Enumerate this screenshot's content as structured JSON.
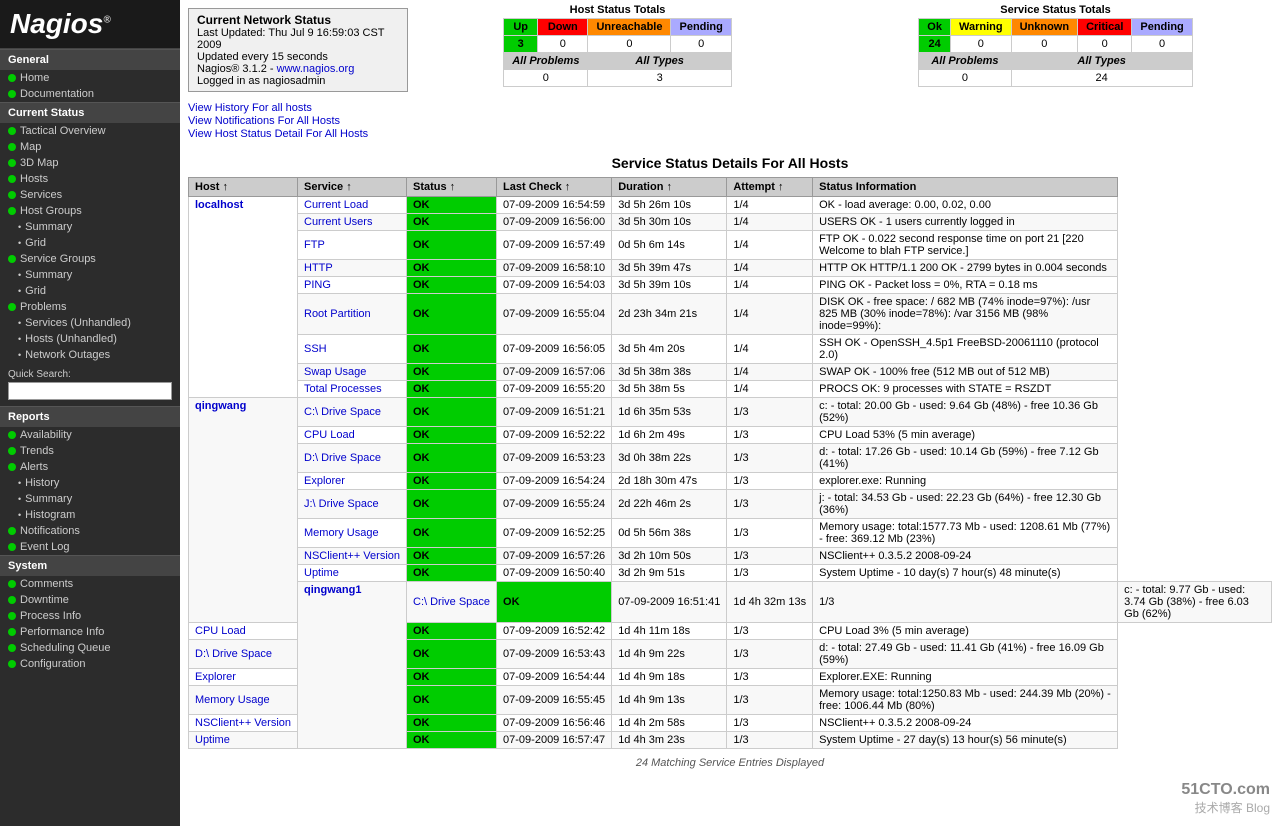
{
  "sidebar": {
    "logo": "Nagios",
    "logo_sup": "®",
    "sections": [
      {
        "label": "General",
        "items": [
          {
            "id": "home",
            "label": "Home",
            "dot": "green",
            "indent": 0
          },
          {
            "id": "documentation",
            "label": "Documentation",
            "dot": "green",
            "indent": 0
          }
        ]
      },
      {
        "label": "Current Status",
        "items": [
          {
            "id": "tactical-overview",
            "label": "Tactical Overview",
            "dot": "green",
            "indent": 0
          },
          {
            "id": "map",
            "label": "Map",
            "dot": "green",
            "indent": 0
          },
          {
            "id": "3d-map",
            "label": "3D Map",
            "dot": "green",
            "indent": 0
          },
          {
            "id": "hosts",
            "label": "Hosts",
            "dot": "green",
            "indent": 0
          },
          {
            "id": "services",
            "label": "Services",
            "dot": "green",
            "indent": 0
          },
          {
            "id": "host-groups",
            "label": "Host Groups",
            "dot": "green",
            "indent": 0
          },
          {
            "id": "hg-summary",
            "label": "Summary",
            "bullet": true,
            "indent": 1
          },
          {
            "id": "hg-grid",
            "label": "Grid",
            "bullet": true,
            "indent": 1
          },
          {
            "id": "service-groups",
            "label": "Service Groups",
            "dot": "green",
            "indent": 0
          },
          {
            "id": "sg-summary",
            "label": "Summary",
            "bullet": true,
            "indent": 1
          },
          {
            "id": "sg-grid",
            "label": "Grid",
            "bullet": true,
            "indent": 1
          },
          {
            "id": "problems",
            "label": "Problems",
            "dot": "green",
            "indent": 0
          },
          {
            "id": "prob-services",
            "label": "Services (Unhandled)",
            "bullet": true,
            "indent": 1
          },
          {
            "id": "prob-hosts",
            "label": "Hosts (Unhandled)",
            "bullet": true,
            "indent": 1
          },
          {
            "id": "prob-network",
            "label": "Network Outages",
            "bullet": true,
            "indent": 1
          }
        ]
      },
      {
        "label": "Reports",
        "items": [
          {
            "id": "availability",
            "label": "Availability",
            "dot": "green",
            "indent": 0
          },
          {
            "id": "trends",
            "label": "Trends",
            "dot": "green",
            "indent": 0
          },
          {
            "id": "alerts",
            "label": "Alerts",
            "dot": "green",
            "indent": 0
          },
          {
            "id": "alerts-history",
            "label": "History",
            "bullet": true,
            "indent": 1
          },
          {
            "id": "alerts-summary",
            "label": "Summary",
            "bullet": true,
            "indent": 1
          },
          {
            "id": "alerts-histogram",
            "label": "Histogram",
            "bullet": true,
            "indent": 1
          },
          {
            "id": "notifications",
            "label": "Notifications",
            "dot": "green",
            "indent": 0
          },
          {
            "id": "event-log",
            "label": "Event Log",
            "dot": "green",
            "indent": 0
          }
        ]
      },
      {
        "label": "System",
        "items": [
          {
            "id": "comments",
            "label": "Comments",
            "dot": "green",
            "indent": 0
          },
          {
            "id": "downtime",
            "label": "Downtime",
            "dot": "green",
            "indent": 0
          },
          {
            "id": "process-info",
            "label": "Process Info",
            "dot": "green",
            "indent": 0
          },
          {
            "id": "performance-info",
            "label": "Performance Info",
            "dot": "green",
            "indent": 0
          },
          {
            "id": "scheduling-queue",
            "label": "Scheduling Queue",
            "dot": "green",
            "indent": 0
          },
          {
            "id": "configuration",
            "label": "Configuration",
            "dot": "green",
            "indent": 0
          }
        ]
      }
    ],
    "quick_search_label": "Quick Search:",
    "quick_search_placeholder": ""
  },
  "header": {
    "title": "Current Network Status",
    "last_updated": "Last Updated: Thu Jul 9 16:59:03 CST 2009",
    "update_interval": "Updated every 15 seconds",
    "version": "Nagios® 3.1.2 - ",
    "version_link_text": "www.nagios.org",
    "version_link": "http://www.nagios.org",
    "logged_in": "Logged in as nagiosadmin"
  },
  "links": {
    "view_history": "View History For all hosts",
    "view_notifications": "View Notifications For All Hosts",
    "view_host_status": "View Host Status Detail For All Hosts"
  },
  "host_status_totals": {
    "title": "Host Status Totals",
    "headers": [
      "Up",
      "Down",
      "Unreachable",
      "Pending"
    ],
    "values": [
      "3",
      "0",
      "0",
      "0"
    ],
    "all_problems_label": "All Problems",
    "all_types_label": "All Types",
    "all_problems_value": "0",
    "all_types_value": "3"
  },
  "service_status_totals": {
    "title": "Service Status Totals",
    "headers": [
      "Ok",
      "Warning",
      "Unknown",
      "Critical",
      "Pending"
    ],
    "values": [
      "24",
      "0",
      "0",
      "0",
      "0"
    ],
    "all_problems_label": "All Problems",
    "all_types_label": "All Types",
    "all_problems_value": "0",
    "all_types_value": "24"
  },
  "service_table": {
    "title": "Service Status Details For All Hosts",
    "headers": [
      "Host",
      "Service",
      "Status",
      "Last Check",
      "Duration",
      "Attempt",
      "Status Information"
    ],
    "rows": [
      {
        "host": "localhost",
        "host_rowspan": 9,
        "service": "Current Load",
        "status": "OK",
        "last_check": "07-09-2009 16:54:59",
        "duration": "3d 5h 26m 10s",
        "attempt": "1/4",
        "info": "OK - load average: 0.00, 0.02, 0.00"
      },
      {
        "host": "",
        "service": "Current Users",
        "status": "OK",
        "last_check": "07-09-2009 16:56:00",
        "duration": "3d 5h 30m 10s",
        "attempt": "1/4",
        "info": "USERS OK - 1 users currently logged in"
      },
      {
        "host": "",
        "service": "FTP",
        "status": "OK",
        "last_check": "07-09-2009 16:57:49",
        "duration": "0d 5h 6m 14s",
        "attempt": "1/4",
        "info": "FTP OK - 0.022 second response time on port 21 [220 Welcome to blah FTP service.]"
      },
      {
        "host": "",
        "service": "HTTP",
        "status": "OK",
        "last_check": "07-09-2009 16:58:10",
        "duration": "3d 5h 39m 47s",
        "attempt": "1/4",
        "info": "HTTP OK HTTP/1.1 200 OK - 2799 bytes in 0.004 seconds"
      },
      {
        "host": "",
        "service": "PING",
        "status": "OK",
        "last_check": "07-09-2009 16:54:03",
        "duration": "3d 5h 39m 10s",
        "attempt": "1/4",
        "info": "PING OK - Packet loss = 0%, RTA = 0.18 ms"
      },
      {
        "host": "",
        "service": "Root Partition",
        "status": "OK",
        "last_check": "07-09-2009 16:55:04",
        "duration": "2d 23h 34m 21s",
        "attempt": "1/4",
        "info": "DISK OK - free space: / 682 MB (74% inode=97%): /usr 825 MB (30% inode=78%): /var 3156 MB (98% inode=99%):"
      },
      {
        "host": "",
        "service": "SSH",
        "status": "OK",
        "last_check": "07-09-2009 16:56:05",
        "duration": "3d 5h 4m 20s",
        "attempt": "1/4",
        "info": "SSH OK - OpenSSH_4.5p1 FreeBSD-20061110 (protocol 2.0)"
      },
      {
        "host": "",
        "service": "Swap Usage",
        "status": "OK",
        "last_check": "07-09-2009 16:57:06",
        "duration": "3d 5h 38m 38s",
        "attempt": "1/4",
        "info": "SWAP OK - 100% free (512 MB out of 512 MB)"
      },
      {
        "host": "",
        "service": "Total Processes",
        "status": "OK",
        "last_check": "07-09-2009 16:55:20",
        "duration": "3d 5h 38m 5s",
        "attempt": "1/4",
        "info": "PROCS OK: 9 processes with STATE = RSZDT"
      },
      {
        "host": "qingwang",
        "host_rowspan": 9,
        "service": "C:\\ Drive Space",
        "status": "OK",
        "last_check": "07-09-2009 16:51:21",
        "duration": "1d 6h 35m 53s",
        "attempt": "1/3",
        "info": "c: - total: 20.00 Gb - used: 9.64 Gb (48%) - free 10.36 Gb (52%)"
      },
      {
        "host": "",
        "service": "CPU Load",
        "status": "OK",
        "last_check": "07-09-2009 16:52:22",
        "duration": "1d 6h 2m 49s",
        "attempt": "1/3",
        "info": "CPU Load 53% (5 min average)"
      },
      {
        "host": "",
        "service": "D:\\ Drive Space",
        "status": "OK",
        "last_check": "07-09-2009 16:53:23",
        "duration": "3d 0h 38m 22s",
        "attempt": "1/3",
        "info": "d: - total: 17.26 Gb - used: 10.14 Gb (59%) - free 7.12 Gb (41%)"
      },
      {
        "host": "",
        "service": "Explorer",
        "status": "OK",
        "last_check": "07-09-2009 16:54:24",
        "duration": "2d 18h 30m 47s",
        "attempt": "1/3",
        "info": "explorer.exe: Running"
      },
      {
        "host": "",
        "service": "J:\\ Drive Space",
        "status": "OK",
        "last_check": "07-09-2009 16:55:24",
        "duration": "2d 22h 46m 2s",
        "attempt": "1/3",
        "info": "j: - total: 34.53 Gb - used: 22.23 Gb (64%) - free 12.30 Gb (36%)"
      },
      {
        "host": "",
        "service": "Memory Usage",
        "status": "OK",
        "last_check": "07-09-2009 16:52:25",
        "duration": "0d 5h 56m 38s",
        "attempt": "1/3",
        "info": "Memory usage: total:1577.73 Mb - used: 1208.61 Mb (77%) - free: 369.12 Mb (23%)"
      },
      {
        "host": "",
        "service": "NSClient++ Version",
        "status": "OK",
        "last_check": "07-09-2009 16:57:26",
        "duration": "3d 2h 10m 50s",
        "attempt": "1/3",
        "info": "NSClient++ 0.3.5.2 2008-09-24"
      },
      {
        "host": "",
        "service": "Uptime",
        "status": "OK",
        "last_check": "07-09-2009 16:50:40",
        "duration": "3d 2h 9m 51s",
        "attempt": "1/3",
        "info": "System Uptime - 10 day(s) 7 hour(s) 48 minute(s)"
      },
      {
        "host": "qingwang1",
        "host_rowspan": 7,
        "service": "C:\\ Drive Space",
        "status": "OK",
        "last_check": "07-09-2009 16:51:41",
        "duration": "1d 4h 32m 13s",
        "attempt": "1/3",
        "info": "c: - total: 9.77 Gb - used: 3.74 Gb (38%) - free 6.03 Gb (62%)"
      },
      {
        "host": "",
        "service": "CPU Load",
        "status": "OK",
        "last_check": "07-09-2009 16:52:42",
        "duration": "1d 4h 11m 18s",
        "attempt": "1/3",
        "info": "CPU Load 3% (5 min average)"
      },
      {
        "host": "",
        "service": "D:\\ Drive Space",
        "status": "OK",
        "last_check": "07-09-2009 16:53:43",
        "duration": "1d 4h 9m 22s",
        "attempt": "1/3",
        "info": "d: - total: 27.49 Gb - used: 11.41 Gb (41%) - free 16.09 Gb (59%)"
      },
      {
        "host": "",
        "service": "Explorer",
        "status": "OK",
        "last_check": "07-09-2009 16:54:44",
        "duration": "1d 4h 9m 18s",
        "attempt": "1/3",
        "info": "Explorer.EXE: Running"
      },
      {
        "host": "",
        "service": "Memory Usage",
        "status": "OK",
        "last_check": "07-09-2009 16:55:45",
        "duration": "1d 4h 9m 13s",
        "attempt": "1/3",
        "info": "Memory usage: total:1250.83 Mb - used: 244.39 Mb (20%) - free: 1006.44 Mb (80%)"
      },
      {
        "host": "",
        "service": "NSClient++ Version",
        "status": "OK",
        "last_check": "07-09-2009 16:56:46",
        "duration": "1d 4h 2m 58s",
        "attempt": "1/3",
        "info": "NSClient++ 0.3.5.2 2008-09-24"
      },
      {
        "host": "",
        "service": "Uptime",
        "status": "OK",
        "last_check": "07-09-2009 16:57:47",
        "duration": "1d 4h 3m 23s",
        "attempt": "1/3",
        "info": "System Uptime - 27 day(s) 13 hour(s) 56 minute(s)"
      }
    ],
    "matching_count": "24 Matching Service Entries Displayed"
  },
  "watermark": {
    "site": "51CTO.com",
    "sub": "技术博客  Blog"
  }
}
